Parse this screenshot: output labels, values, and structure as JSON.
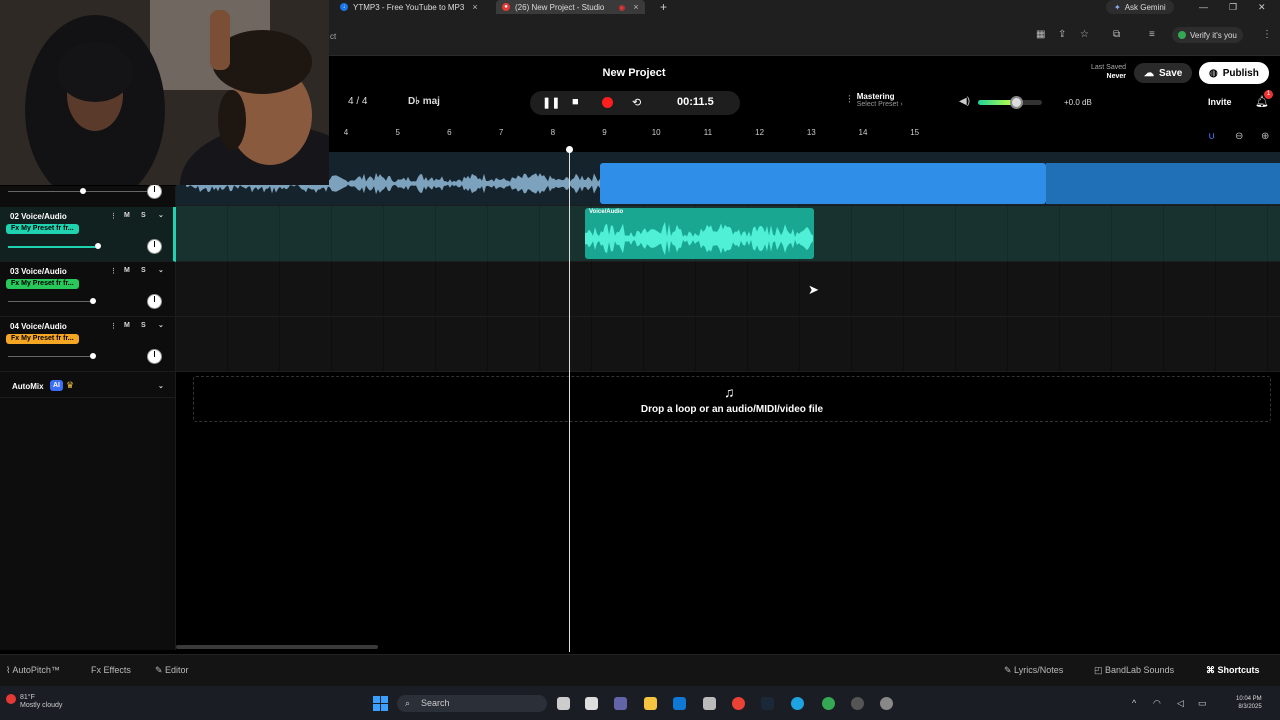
{
  "browser": {
    "tabs": [
      {
        "label": "YTMP3 - Free YouTube to MP3"
      },
      {
        "label": "(26) New Project - Studio"
      }
    ],
    "ask_gemini": "Ask Gemini",
    "address_fragment": "ct",
    "verify": "Verify it's you"
  },
  "header": {
    "project_title": "New Project",
    "last_saved_label": "Last Saved",
    "last_saved_value": "Never",
    "save_label": "Save",
    "publish_label": "Publish",
    "invite_label": "Invite",
    "notification_count": "1"
  },
  "transport": {
    "time_signature": "4 / 4",
    "key": "D♭ maj",
    "timecode": "00:11.5",
    "mastering_label": "Mastering",
    "mastering_preset": "Select Preset",
    "volume_db": "+0.0 dB",
    "volume_level": 0.6
  },
  "ruler": {
    "bars": [
      "4",
      "5",
      "6",
      "7",
      "8",
      "9",
      "10",
      "11",
      "12",
      "13",
      "14",
      "15"
    ]
  },
  "tracks": [
    {
      "name": "02 Voice/Audio",
      "fx": "Fx My Preset fr fr...",
      "fx_color": "#1fd3b0",
      "mute": "M",
      "solo": "S",
      "selected": true
    },
    {
      "name": "03 Voice/Audio",
      "fx": "Fx My Preset fr fr...",
      "fx_color": "#28c85a",
      "mute": "M",
      "solo": "S",
      "selected": false
    },
    {
      "name": "04 Voice/Audio",
      "fx": "Fx My Preset fr fr...",
      "fx_color": "#f5a623",
      "mute": "M",
      "solo": "S",
      "selected": false
    }
  ],
  "automix": {
    "label": "AutoMix",
    "ai_badge": "AI"
  },
  "clips": {
    "voice_clip_label": "Voice/Audio"
  },
  "dropzone": {
    "text": "Drop a loop or an audio/MIDI/video file"
  },
  "bottom_bar": {
    "autopitch": "AutoPitch™",
    "effects": "Effects",
    "editor": "Editor",
    "lyrics": "Lyrics/Notes",
    "sounds": "BandLab Sounds",
    "shortcuts": "Shortcuts"
  },
  "taskbar": {
    "weather_temp": "81°F",
    "weather_desc": "Mostly cloudy",
    "search": "Search",
    "time": "10:04 PM",
    "date": "8/3/2025"
  },
  "colors": {
    "accent_teal": "#1fd3b0",
    "clip_blue": "#2f8fe8",
    "record_red": "#ff1f1f"
  }
}
